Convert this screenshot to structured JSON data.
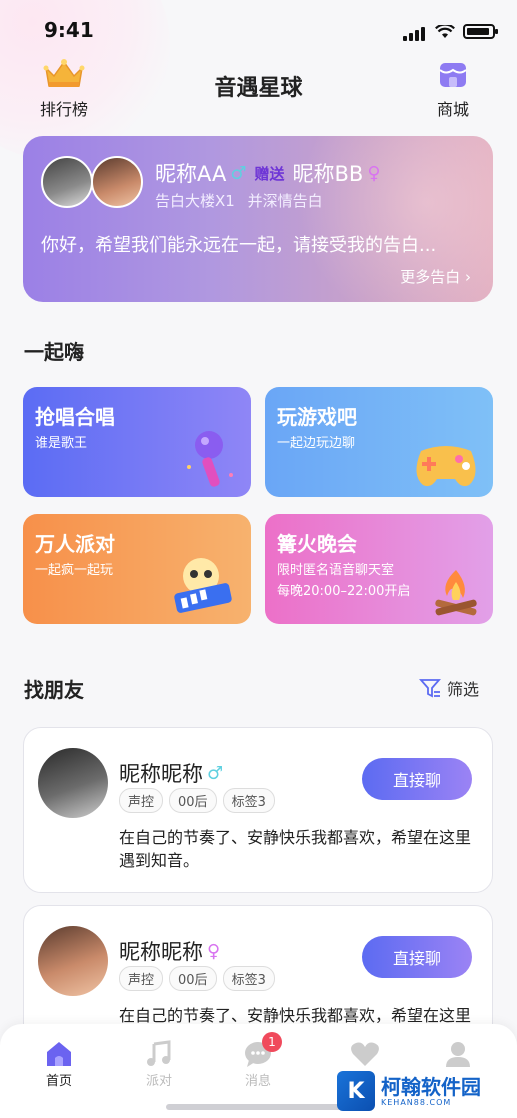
{
  "status": {
    "time": "9:41"
  },
  "header": {
    "left_label": "排行榜",
    "title": "音遇星球",
    "right_label": "商城"
  },
  "banner": {
    "from_name": "昵称AA",
    "gift_word": "赠送",
    "to_name": "昵称BB",
    "gift_detail": "告白大楼X1",
    "gift_note": "并深情告白",
    "message": "你好，希望我们能永远在一起，请接受我的告白...",
    "more": "更多告白"
  },
  "section1": {
    "title": "一起嗨"
  },
  "cards": [
    {
      "title": "抢唱合唱",
      "sub": "谁是歌王",
      "icon": "microphone-icon"
    },
    {
      "title": "玩游戏吧",
      "sub": "一起边玩边聊",
      "icon": "gamepad-icon"
    },
    {
      "title": "万人派对",
      "sub": "一起疯一起玩",
      "icon": "party-icon"
    },
    {
      "title": "篝火晚会",
      "sub": "限时匿名语音聊天室",
      "sub2": "每晚20:00–22:00开启",
      "icon": "campfire-icon"
    }
  ],
  "section2": {
    "title": "找朋友",
    "filter": "筛选"
  },
  "friends": [
    {
      "name": "昵称昵称",
      "gender": "male",
      "tags": [
        "声控",
        "00后",
        "标签3"
      ],
      "desc": "在自己的节奏了、安静快乐我都喜欢，希望在这里遇到知音。",
      "action": "直接聊"
    },
    {
      "name": "昵称昵称",
      "gender": "female",
      "tags": [
        "声控",
        "00后",
        "标签3"
      ],
      "desc": "在自己的节奏了、安静快乐我都喜欢，希望在这里遇到知音。",
      "action": "直接聊"
    }
  ],
  "tabs": [
    {
      "label": "首页",
      "icon": "home-icon",
      "active": true
    },
    {
      "label": "派对",
      "icon": "music-icon"
    },
    {
      "label": "消息",
      "icon": "message-icon",
      "badge": "1"
    },
    {
      "label": "",
      "icon": "heart-icon"
    },
    {
      "label": "",
      "icon": "profile-icon"
    }
  ],
  "watermark": {
    "text": "柯翰软件园",
    "sub": "KEHAN88.COM"
  },
  "colors": {
    "accent": "#5c6bf2",
    "male": "#5fd0e0",
    "female": "#d874f0"
  }
}
